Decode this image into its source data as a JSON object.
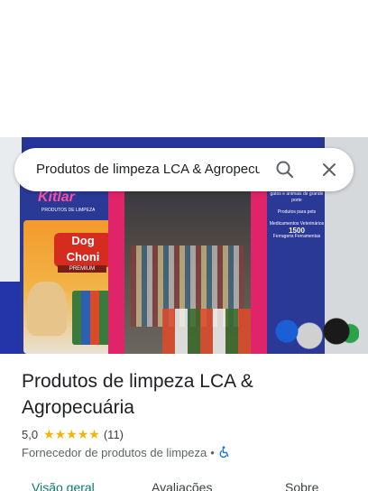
{
  "search": {
    "query": "Produtos de limpeza LCA & Agropecuária"
  },
  "photo": {
    "brand_sign": "Kitlar",
    "brand_sub": "PRODUTOS DE LIMPEZA",
    "product_logo": "Dog Choni",
    "product_sub": "PREMIUM",
    "right_sign_lines": [
      "gatos e animais de grande porte",
      "Produtos para pets",
      "Medicamentos Veterinários",
      "Ferragens Ferramentas"
    ],
    "right_sign_number": "1500"
  },
  "place": {
    "name": "Produtos de limpeza LCA & Agropecuária",
    "rating": "5,0",
    "stars": "★★★★★",
    "review_count": "(11)",
    "category": "Fornecedor de produtos de limpeza",
    "separator": "•"
  },
  "tabs": [
    {
      "label": "Visão geral",
      "active": true
    },
    {
      "label": "Avaliações",
      "active": false
    },
    {
      "label": "Sobre",
      "active": false
    }
  ],
  "colors": {
    "accent": "#0b7a6e",
    "star": "#f4b400",
    "accessibility": "#1a73e8"
  },
  "icons": {
    "search": "search-icon",
    "close": "close-icon",
    "accessibility": "wheelchair-icon"
  }
}
